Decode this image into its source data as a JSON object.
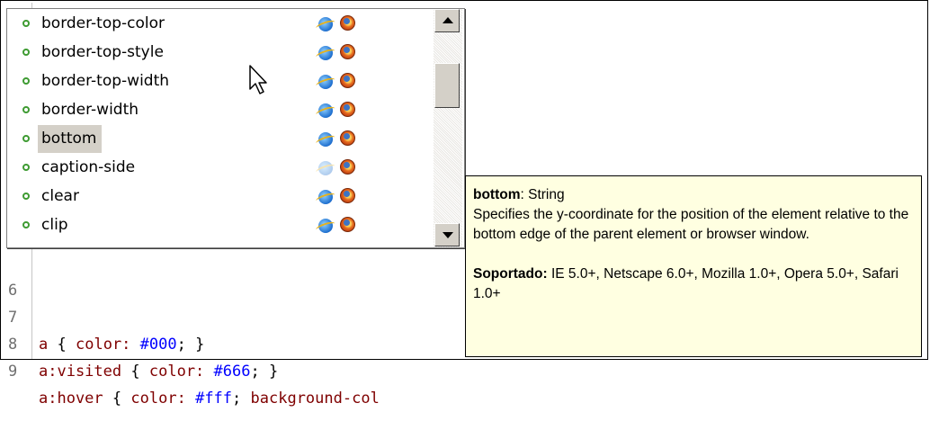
{
  "editor": {
    "lines": [
      {
        "n": "6",
        "selector": "",
        "prop": "",
        "value": ""
      },
      {
        "n": "7",
        "selector": "a",
        "prop": "color:",
        "value": "#000",
        "tail": ";",
        "end": " }"
      },
      {
        "n": "8",
        "selector": "a:visited",
        "prop": "color:",
        "value": "#666",
        "tail": ";",
        "end": " }"
      },
      {
        "n": "9",
        "selector": "a:hover",
        "prop": "color:",
        "value": "#fff",
        "tail": ";",
        "extra": " background-col"
      }
    ]
  },
  "autocomplete": {
    "items": [
      {
        "label": "border-top-color",
        "ie": "ie-icon",
        "ff": "firefox-icon"
      },
      {
        "label": "border-top-style",
        "ie": "ie-icon",
        "ff": "firefox-icon"
      },
      {
        "label": "border-top-width",
        "ie": "ie-icon",
        "ff": "firefox-icon"
      },
      {
        "label": "border-width",
        "ie": "ie-icon",
        "ff": "firefox-icon"
      },
      {
        "label": "bottom",
        "ie": "ie-icon",
        "ff": "firefox-icon"
      },
      {
        "label": "caption-side",
        "ie": "ie-icon-faded",
        "ff": "firefox-icon"
      },
      {
        "label": "clear",
        "ie": "ie-icon",
        "ff": "firefox-icon"
      },
      {
        "label": "clip",
        "ie": "ie-icon",
        "ff": "firefox-icon"
      }
    ],
    "highlighted": "bottom"
  },
  "tooltip": {
    "name": "bottom",
    "type": ": String",
    "description": "Specifies the y-coordinate for the position of the element relative to the bottom edge of the parent element or browser window.",
    "supported_label": "Soportado:",
    "supported_value": " IE 5.0+, Netscape 6.0+, Mozilla 1.0+, Opera 5.0+, Safari 1.0+"
  },
  "colors": {
    "tooltip_bg": "#ffffe1",
    "selector": "#7f0000",
    "value": "#0000ff",
    "bullet": "#3e9b32",
    "highlight": "#d4d0c8"
  }
}
